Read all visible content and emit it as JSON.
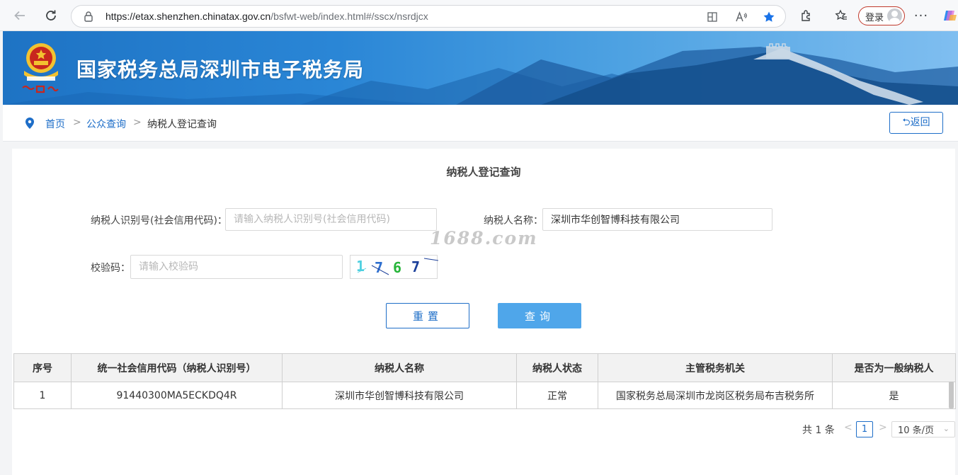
{
  "browser": {
    "url_host": "https://etax.shenzhen.chinatax.gov.cn",
    "url_path": "/bsfwt-web/index.html#/sscx/nsrdjcx",
    "login_label": "登录",
    "icons": [
      "back-arrow-icon",
      "refresh-icon",
      "lock-icon",
      "grid-icon",
      "read-aloud-icon",
      "favorite-star-icon",
      "extensions-icon",
      "favorites-icon",
      "avatar-icon",
      "more-icon",
      "copilot-icon"
    ]
  },
  "header": {
    "title": "国家税务总局深圳市电子税务局",
    "colors": {
      "banner": "#2a86d6",
      "accent": "#1e6ec8",
      "query_button": "#4fa6ea"
    }
  },
  "breadcrumb": {
    "home": "首页",
    "sep": ">",
    "public_query": "公众查询",
    "current": "纳税人登记查询",
    "back_label": "⮌返回"
  },
  "form": {
    "title": "纳税人登记查询",
    "taxpayer_id_label": "纳税人识别号(社会信用代码)：",
    "taxpayer_id_placeholder": "请输入纳税人识别号(社会信用代码)",
    "taxpayer_id_value": "",
    "taxpayer_name_label": "纳税人名称：",
    "taxpayer_name_value": "深圳市华创智博科技有限公司",
    "captcha_label": "校验码：",
    "captcha_placeholder": "请输入校验码",
    "captcha_value": "",
    "captcha_chars": [
      "1",
      "7",
      "6",
      "7"
    ],
    "reset_label": "重置",
    "query_label": "查询"
  },
  "watermark": "1688.com",
  "table": {
    "headers": [
      "序号",
      "统一社会信用代码（纳税人识别号）",
      "纳税人名称",
      "纳税人状态",
      "主管税务机关",
      "是否为一般纳税人"
    ],
    "rows": [
      [
        "1",
        "91440300MA5ECKDQ4R",
        "深圳市华创智博科技有限公司",
        "正常",
        "国家税务总局深圳市龙岗区税务局布吉税务所",
        "是"
      ]
    ]
  },
  "pagination": {
    "total": "共 1 条",
    "prev": "<",
    "current_page": "1",
    "next": ">",
    "page_size": "10 条/页"
  }
}
